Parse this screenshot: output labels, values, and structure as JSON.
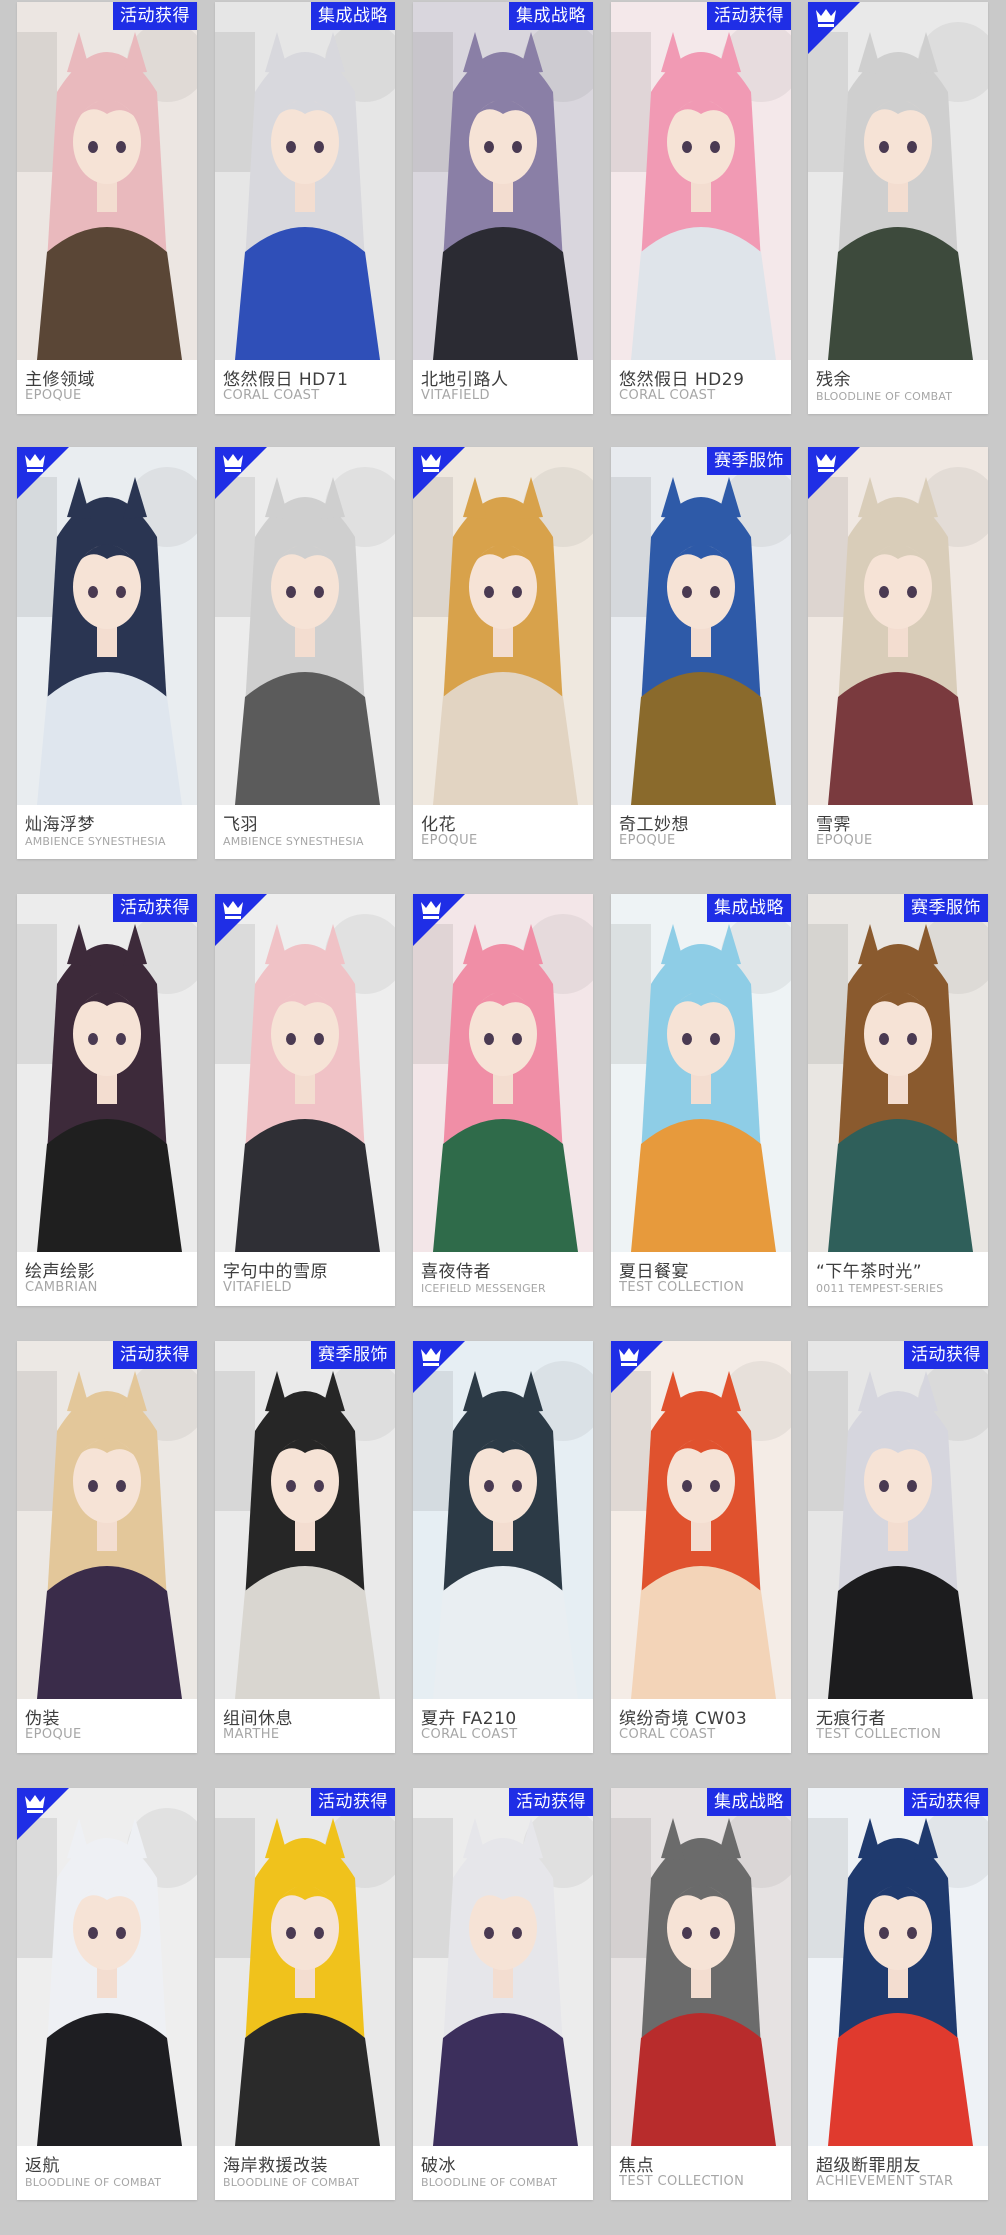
{
  "badges": {
    "event": "活动获得",
    "integrated": "集成战略",
    "season": "赛季服饰"
  },
  "cards": [
    {
      "name": "主修领域",
      "series": "EPOQUE",
      "badge": "活动获得",
      "hair": "#e9b9bd",
      "outfit": "#5a4636",
      "bg": "#ece6e2"
    },
    {
      "name": "悠然假日 HD71",
      "series": "CORAL COAST",
      "badge": "集成战略",
      "hair": "#d8d8dd",
      "outfit": "#2f4fb8",
      "bg": "#e6e6e6"
    },
    {
      "name": "北地引路人",
      "series": "VITAFIELD",
      "badge": "集成战略",
      "hair": "#8a7fa6",
      "outfit": "#2b2b33",
      "bg": "#d9d6dd"
    },
    {
      "name": "悠然假日 HD29",
      "series": "CORAL COAST",
      "badge": "活动获得",
      "hair": "#f19ab4",
      "outfit": "#dfe4ea",
      "bg": "#f4e8ea"
    },
    {
      "name": "残余",
      "series": "BLOODLINE OF COMBAT",
      "badge": "",
      "hair": "#cfcfcf",
      "outfit": "#3d4a3c",
      "bg": "#e9e9e9"
    },
    {
      "name": "灿海浮梦",
      "series": "AMBIENCE SYNESTHESIA",
      "badge": "",
      "hair": "#2a3552",
      "outfit": "#dfe6ee",
      "bg": "#e9edf0"
    },
    {
      "name": "飞羽",
      "series": "AMBIENCE SYNESTHESIA",
      "badge": "",
      "hair": "#cfcfcf",
      "outfit": "#5b5b5b",
      "bg": "#ececec"
    },
    {
      "name": "化花",
      "series": "EPOQUE",
      "badge": "",
      "hair": "#d8a24b",
      "outfit": "#e2d4c2",
      "bg": "#efe8df"
    },
    {
      "name": "奇工妙想",
      "series": "EPOQUE",
      "badge": "赛季服饰",
      "hair": "#2e5aa8",
      "outfit": "#8a6a2c",
      "bg": "#e8ebef"
    },
    {
      "name": "雪霁",
      "series": "EPOQUE",
      "badge": "",
      "hair": "#d9cdb9",
      "outfit": "#7a3a3e",
      "bg": "#f0e8e2"
    },
    {
      "name": "绘声绘影",
      "series": "CAMBRIAN",
      "badge": "活动获得",
      "hair": "#3d2a3a",
      "outfit": "#1f1f1f",
      "bg": "#ececec"
    },
    {
      "name": "字句中的雪原",
      "series": "VITAFIELD",
      "badge": "",
      "hair": "#f0c2c6",
      "outfit": "#2f2f35",
      "bg": "#eeeeee"
    },
    {
      "name": "喜夜侍者",
      "series": "ICEFIELD MESSENGER",
      "badge": "",
      "hair": "#f08ea6",
      "outfit": "#2f6b4a",
      "bg": "#f3e6e8"
    },
    {
      "name": "夏日餐宴",
      "series": "TEST COLLECTION",
      "badge": "集成战略",
      "hair": "#8ecde6",
      "outfit": "#e79a3c",
      "bg": "#eef3f5"
    },
    {
      "name": "“下午茶时光”",
      "series": "0011 TEMPEST-SERIES",
      "badge": "赛季服饰",
      "hair": "#8a5a2e",
      "outfit": "#2f5f5a",
      "bg": "#e9e6e2"
    },
    {
      "name": "伪装",
      "series": "EPOQUE",
      "badge": "活动获得",
      "hair": "#e3c79a",
      "outfit": "#3a2c4a",
      "bg": "#ece8e4"
    },
    {
      "name": "组间休息",
      "series": "MARTHE",
      "badge": "赛季服饰",
      "hair": "#262626",
      "outfit": "#d9d6d0",
      "bg": "#eaeaea"
    },
    {
      "name": "夏卉 FA210",
      "series": "CORAL COAST",
      "badge": "",
      "hair": "#2c3a46",
      "outfit": "#e9eef2",
      "bg": "#e6eef3"
    },
    {
      "name": "缤纷奇境 CW03",
      "series": "CORAL COAST",
      "badge": "",
      "hair": "#e0522e",
      "outfit": "#f3d4b8",
      "bg": "#f4ece6"
    },
    {
      "name": "无痕行者",
      "series": "TEST COLLECTION",
      "badge": "活动获得",
      "hair": "#d6d6de",
      "outfit": "#1c1c1e",
      "bg": "#e6e6e6"
    },
    {
      "name": "返航",
      "series": "BLOODLINE OF COMBAT",
      "badge": "",
      "hair": "#eef0f4",
      "outfit": "#1e1e22",
      "bg": "#eeeeee"
    },
    {
      "name": "海岸救援改装",
      "series": "BLOODLINE OF COMBAT",
      "badge": "活动获得",
      "hair": "#f0c21c",
      "outfit": "#2a2a2a",
      "bg": "#e9e9e9"
    },
    {
      "name": "破冰",
      "series": "BLOODLINE OF COMBAT",
      "badge": "活动获得",
      "hair": "#e6e6ea",
      "outfit": "#3c2f5c",
      "bg": "#ececec"
    },
    {
      "name": "焦点",
      "series": "TEST COLLECTION",
      "badge": "集成战略",
      "hair": "#6b6b6b",
      "outfit": "#b82c2c",
      "bg": "#e6e2e2"
    },
    {
      "name": "超级断罪朋友",
      "series": "ACHIEVEMENT STAR",
      "badge": "活动获得",
      "hair": "#1f3a6e",
      "outfit": "#e03a2e",
      "bg": "#eef2f6"
    }
  ],
  "colors": {
    "page_bg": "#c9c9c9",
    "badge_bg": "#1f2ee6",
    "corner_bg": "#1f2ee6",
    "name_text": "#3d3d3d",
    "series_text": "#a6a6a6"
  }
}
